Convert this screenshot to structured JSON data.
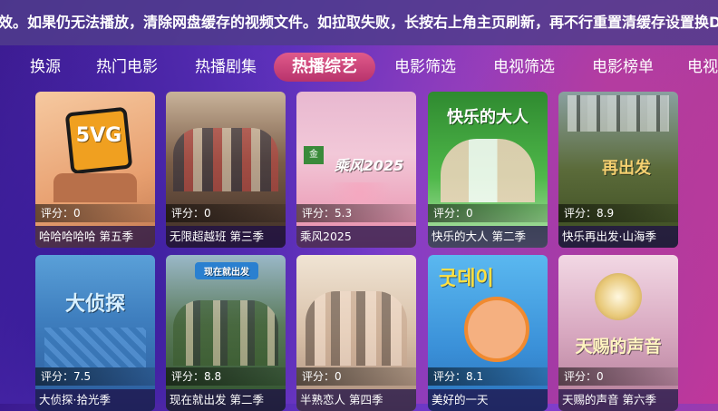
{
  "notice": "效。如果仍无法播放，清除网盘缓存的视频文件。如拉取失败，长按右上角主页刷新，再不行重置清缓存设置换DN",
  "tabs": [
    "换源",
    "热门电影",
    "热播剧集",
    "热播综艺",
    "电影筛选",
    "电视筛选",
    "电影榜单",
    "电视"
  ],
  "active_tab": "热播综艺",
  "score_prefix": "评分：",
  "cards": [
    {
      "title": "哈哈哈哈哈 第五季",
      "score": "0",
      "colors": [
        "#f2b78a",
        "#d88a5a"
      ],
      "logo": "5VG"
    },
    {
      "title": "无限超越班 第三季",
      "score": "0",
      "colors": [
        "#8a6f5a",
        "#4a3a30"
      ],
      "logo": ""
    },
    {
      "title": "乘风2025",
      "score": "5.3",
      "colors": [
        "#f5c7d6",
        "#e58aa8"
      ],
      "logo": "乘风2025"
    },
    {
      "title": "快乐的大人 第二季",
      "score": "0",
      "colors": [
        "#46a845",
        "#2d7a2e"
      ],
      "logo": "快乐的大人"
    },
    {
      "title": "快乐再出发·山海季",
      "score": "8.9",
      "colors": [
        "#5b6b3a",
        "#c88a3a"
      ],
      "logo": "再出发"
    },
    {
      "title": "大侦探·拾光季",
      "score": "7.5",
      "colors": [
        "#3f7fbf",
        "#1f4f8a"
      ],
      "logo": "大侦探"
    },
    {
      "title": "现在就出发 第二季",
      "score": "8.8",
      "colors": [
        "#3d6f3a",
        "#7a9a8a"
      ],
      "logo": "现在就出发"
    },
    {
      "title": "半熟恋人 第四季",
      "score": "0",
      "colors": [
        "#e7d6c3",
        "#b99a82"
      ],
      "logo": ""
    },
    {
      "title": "美好的一天",
      "score": "8.1",
      "colors": [
        "#4aa8e8",
        "#2a78c8"
      ],
      "logo": "굿데이"
    },
    {
      "title": "天赐的声音 第六季",
      "score": "0",
      "colors": [
        "#e9c8d8",
        "#b77a95"
      ],
      "logo": "天赐的声音"
    }
  ]
}
